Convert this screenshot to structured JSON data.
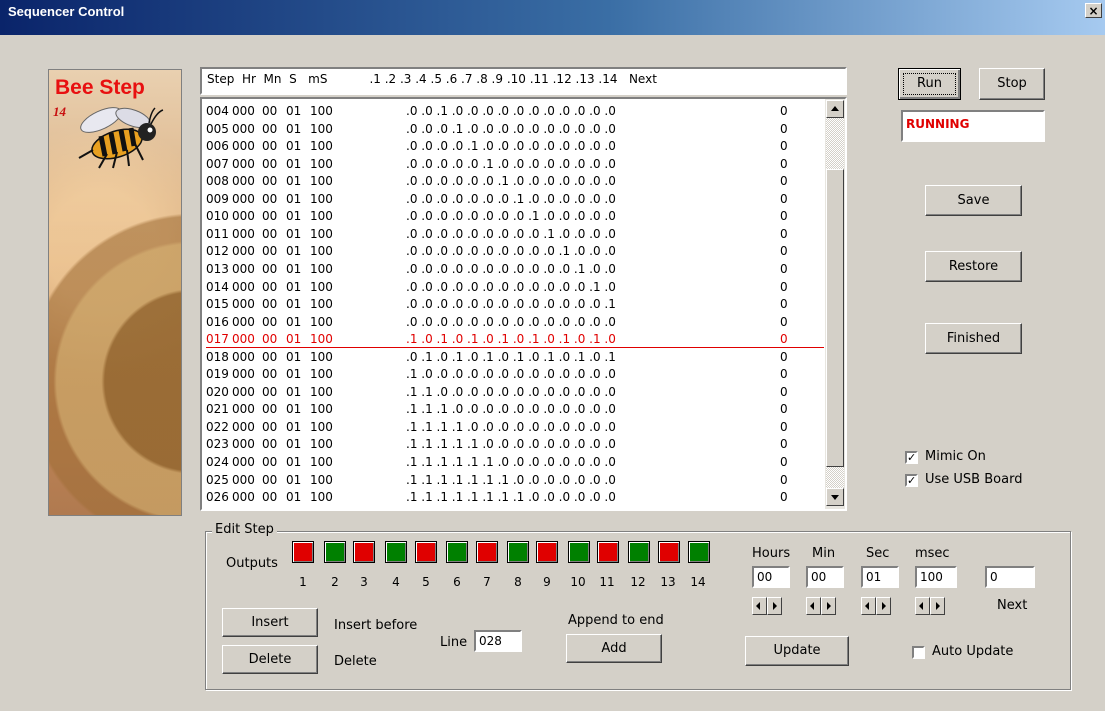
{
  "window": {
    "title": "Sequencer Control",
    "close_glyph": "×"
  },
  "logo": {
    "title": "Bee Step",
    "subtitle": "14"
  },
  "list": {
    "header": "Step  Hr  Mn  S   mS           .1 .2 .3 .4 .5 .6 .7 .8 .9 .10 .11 .12 .13 .14   Next",
    "selected_step": "017",
    "rows": [
      {
        "step": "004",
        "hr": "000",
        "mn": "00",
        "s": "01",
        "ms": "100",
        "outs": ".0 .0 .1 .0 .0 .0 .0 .0 .0 .0 .0 .0 .0 .0",
        "next": "0"
      },
      {
        "step": "005",
        "hr": "000",
        "mn": "00",
        "s": "01",
        "ms": "100",
        "outs": ".0 .0 .0 .1 .0 .0 .0 .0 .0 .0 .0 .0 .0 .0",
        "next": "0"
      },
      {
        "step": "006",
        "hr": "000",
        "mn": "00",
        "s": "01",
        "ms": "100",
        "outs": ".0 .0 .0 .0 .1 .0 .0 .0 .0 .0 .0 .0 .0 .0",
        "next": "0"
      },
      {
        "step": "007",
        "hr": "000",
        "mn": "00",
        "s": "01",
        "ms": "100",
        "outs": ".0 .0 .0 .0 .0 .1 .0 .0 .0 .0 .0 .0 .0 .0",
        "next": "0"
      },
      {
        "step": "008",
        "hr": "000",
        "mn": "00",
        "s": "01",
        "ms": "100",
        "outs": ".0 .0 .0 .0 .0 .0 .1 .0 .0 .0 .0 .0 .0 .0",
        "next": "0"
      },
      {
        "step": "009",
        "hr": "000",
        "mn": "00",
        "s": "01",
        "ms": "100",
        "outs": ".0 .0 .0 .0 .0 .0 .0 .1 .0 .0 .0 .0 .0 .0",
        "next": "0"
      },
      {
        "step": "010",
        "hr": "000",
        "mn": "00",
        "s": "01",
        "ms": "100",
        "outs": ".0 .0 .0 .0 .0 .0 .0 .0 .1 .0 .0 .0 .0 .0",
        "next": "0"
      },
      {
        "step": "011",
        "hr": "000",
        "mn": "00",
        "s": "01",
        "ms": "100",
        "outs": ".0 .0 .0 .0 .0 .0 .0 .0 .0 .1 .0 .0 .0 .0",
        "next": "0"
      },
      {
        "step": "012",
        "hr": "000",
        "mn": "00",
        "s": "01",
        "ms": "100",
        "outs": ".0 .0 .0 .0 .0 .0 .0 .0 .0 .0 .1 .0 .0 .0",
        "next": "0"
      },
      {
        "step": "013",
        "hr": "000",
        "mn": "00",
        "s": "01",
        "ms": "100",
        "outs": ".0 .0 .0 .0 .0 .0 .0 .0 .0 .0 .0 .1 .0 .0",
        "next": "0"
      },
      {
        "step": "014",
        "hr": "000",
        "mn": "00",
        "s": "01",
        "ms": "100",
        "outs": ".0 .0 .0 .0 .0 .0 .0 .0 .0 .0 .0 .0 .1 .0",
        "next": "0"
      },
      {
        "step": "015",
        "hr": "000",
        "mn": "00",
        "s": "01",
        "ms": "100",
        "outs": ".0 .0 .0 .0 .0 .0 .0 .0 .0 .0 .0 .0 .0 .1",
        "next": "0"
      },
      {
        "step": "016",
        "hr": "000",
        "mn": "00",
        "s": "01",
        "ms": "100",
        "outs": ".0 .0 .0 .0 .0 .0 .0 .0 .0 .0 .0 .0 .0 .0",
        "next": "0"
      },
      {
        "step": "017",
        "hr": "000",
        "mn": "00",
        "s": "01",
        "ms": "100",
        "outs": ".1 .0 .1 .0 .1 .0 .1 .0 .1 .0 .1 .0 .1 .0",
        "next": "0"
      },
      {
        "step": "018",
        "hr": "000",
        "mn": "00",
        "s": "01",
        "ms": "100",
        "outs": ".0 .1 .0 .1 .0 .1 .0 .1 .0 .1 .0 .1 .0 .1",
        "next": "0"
      },
      {
        "step": "019",
        "hr": "000",
        "mn": "00",
        "s": "01",
        "ms": "100",
        "outs": ".1 .0 .0 .0 .0 .0 .0 .0 .0 .0 .0 .0 .0 .0",
        "next": "0"
      },
      {
        "step": "020",
        "hr": "000",
        "mn": "00",
        "s": "01",
        "ms": "100",
        "outs": ".1 .1 .0 .0 .0 .0 .0 .0 .0 .0 .0 .0 .0 .0",
        "next": "0"
      },
      {
        "step": "021",
        "hr": "000",
        "mn": "00",
        "s": "01",
        "ms": "100",
        "outs": ".1 .1 .1 .0 .0 .0 .0 .0 .0 .0 .0 .0 .0 .0",
        "next": "0"
      },
      {
        "step": "022",
        "hr": "000",
        "mn": "00",
        "s": "01",
        "ms": "100",
        "outs": ".1 .1 .1 .1 .0 .0 .0 .0 .0 .0 .0 .0 .0 .0",
        "next": "0"
      },
      {
        "step": "023",
        "hr": "000",
        "mn": "00",
        "s": "01",
        "ms": "100",
        "outs": ".1 .1 .1 .1 .1 .0 .0 .0 .0 .0 .0 .0 .0 .0",
        "next": "0"
      },
      {
        "step": "024",
        "hr": "000",
        "mn": "00",
        "s": "01",
        "ms": "100",
        "outs": ".1 .1 .1 .1 .1 .1 .0 .0 .0 .0 .0 .0 .0 .0",
        "next": "0"
      },
      {
        "step": "025",
        "hr": "000",
        "mn": "00",
        "s": "01",
        "ms": "100",
        "outs": ".1 .1 .1 .1 .1 .1 .1 .0 .0 .0 .0 .0 .0 .0",
        "next": "0"
      },
      {
        "step": "026",
        "hr": "000",
        "mn": "00",
        "s": "01",
        "ms": "100",
        "outs": ".1 .1 .1 .1 .1 .1 .1 .1 .0 .0 .0 .0 .0 .0",
        "next": "0"
      }
    ]
  },
  "controls": {
    "run": "Run",
    "stop": "Stop",
    "status": "RUNNING",
    "save": "Save",
    "restore": "Restore",
    "finished": "Finished",
    "mimic_on": "Mimic On",
    "mimic_checked": true,
    "use_usb": "Use USB Board",
    "usb_checked": true
  },
  "edit": {
    "group_title": "Edit Step",
    "outputs_label": "Outputs",
    "outputs": [
      {
        "num": "1",
        "on": false
      },
      {
        "num": "2",
        "on": true
      },
      {
        "num": "3",
        "on": false
      },
      {
        "num": "4",
        "on": true
      },
      {
        "num": "5",
        "on": false
      },
      {
        "num": "6",
        "on": true
      },
      {
        "num": "7",
        "on": false
      },
      {
        "num": "8",
        "on": true
      },
      {
        "num": "9",
        "on": false
      },
      {
        "num": "10",
        "on": true
      },
      {
        "num": "11",
        "on": false
      },
      {
        "num": "12",
        "on": true
      },
      {
        "num": "13",
        "on": false
      },
      {
        "num": "14",
        "on": true
      }
    ],
    "colors": {
      "on": "#008000",
      "off": "#e00000"
    },
    "hours_label": "Hours",
    "hours": "00",
    "min_label": "Min",
    "min": "00",
    "sec_label": "Sec",
    "sec": "01",
    "msec_label": "msec",
    "msec": "100",
    "next_label": "Next",
    "next": "0",
    "insert": "Insert",
    "insert_before": "Insert before",
    "delete": "Delete",
    "delete_label": "Delete",
    "line_label": "Line",
    "line": "028",
    "append_label": "Append to end",
    "add": "Add",
    "update": "Update",
    "auto_update": "Auto Update",
    "auto_update_checked": false
  }
}
